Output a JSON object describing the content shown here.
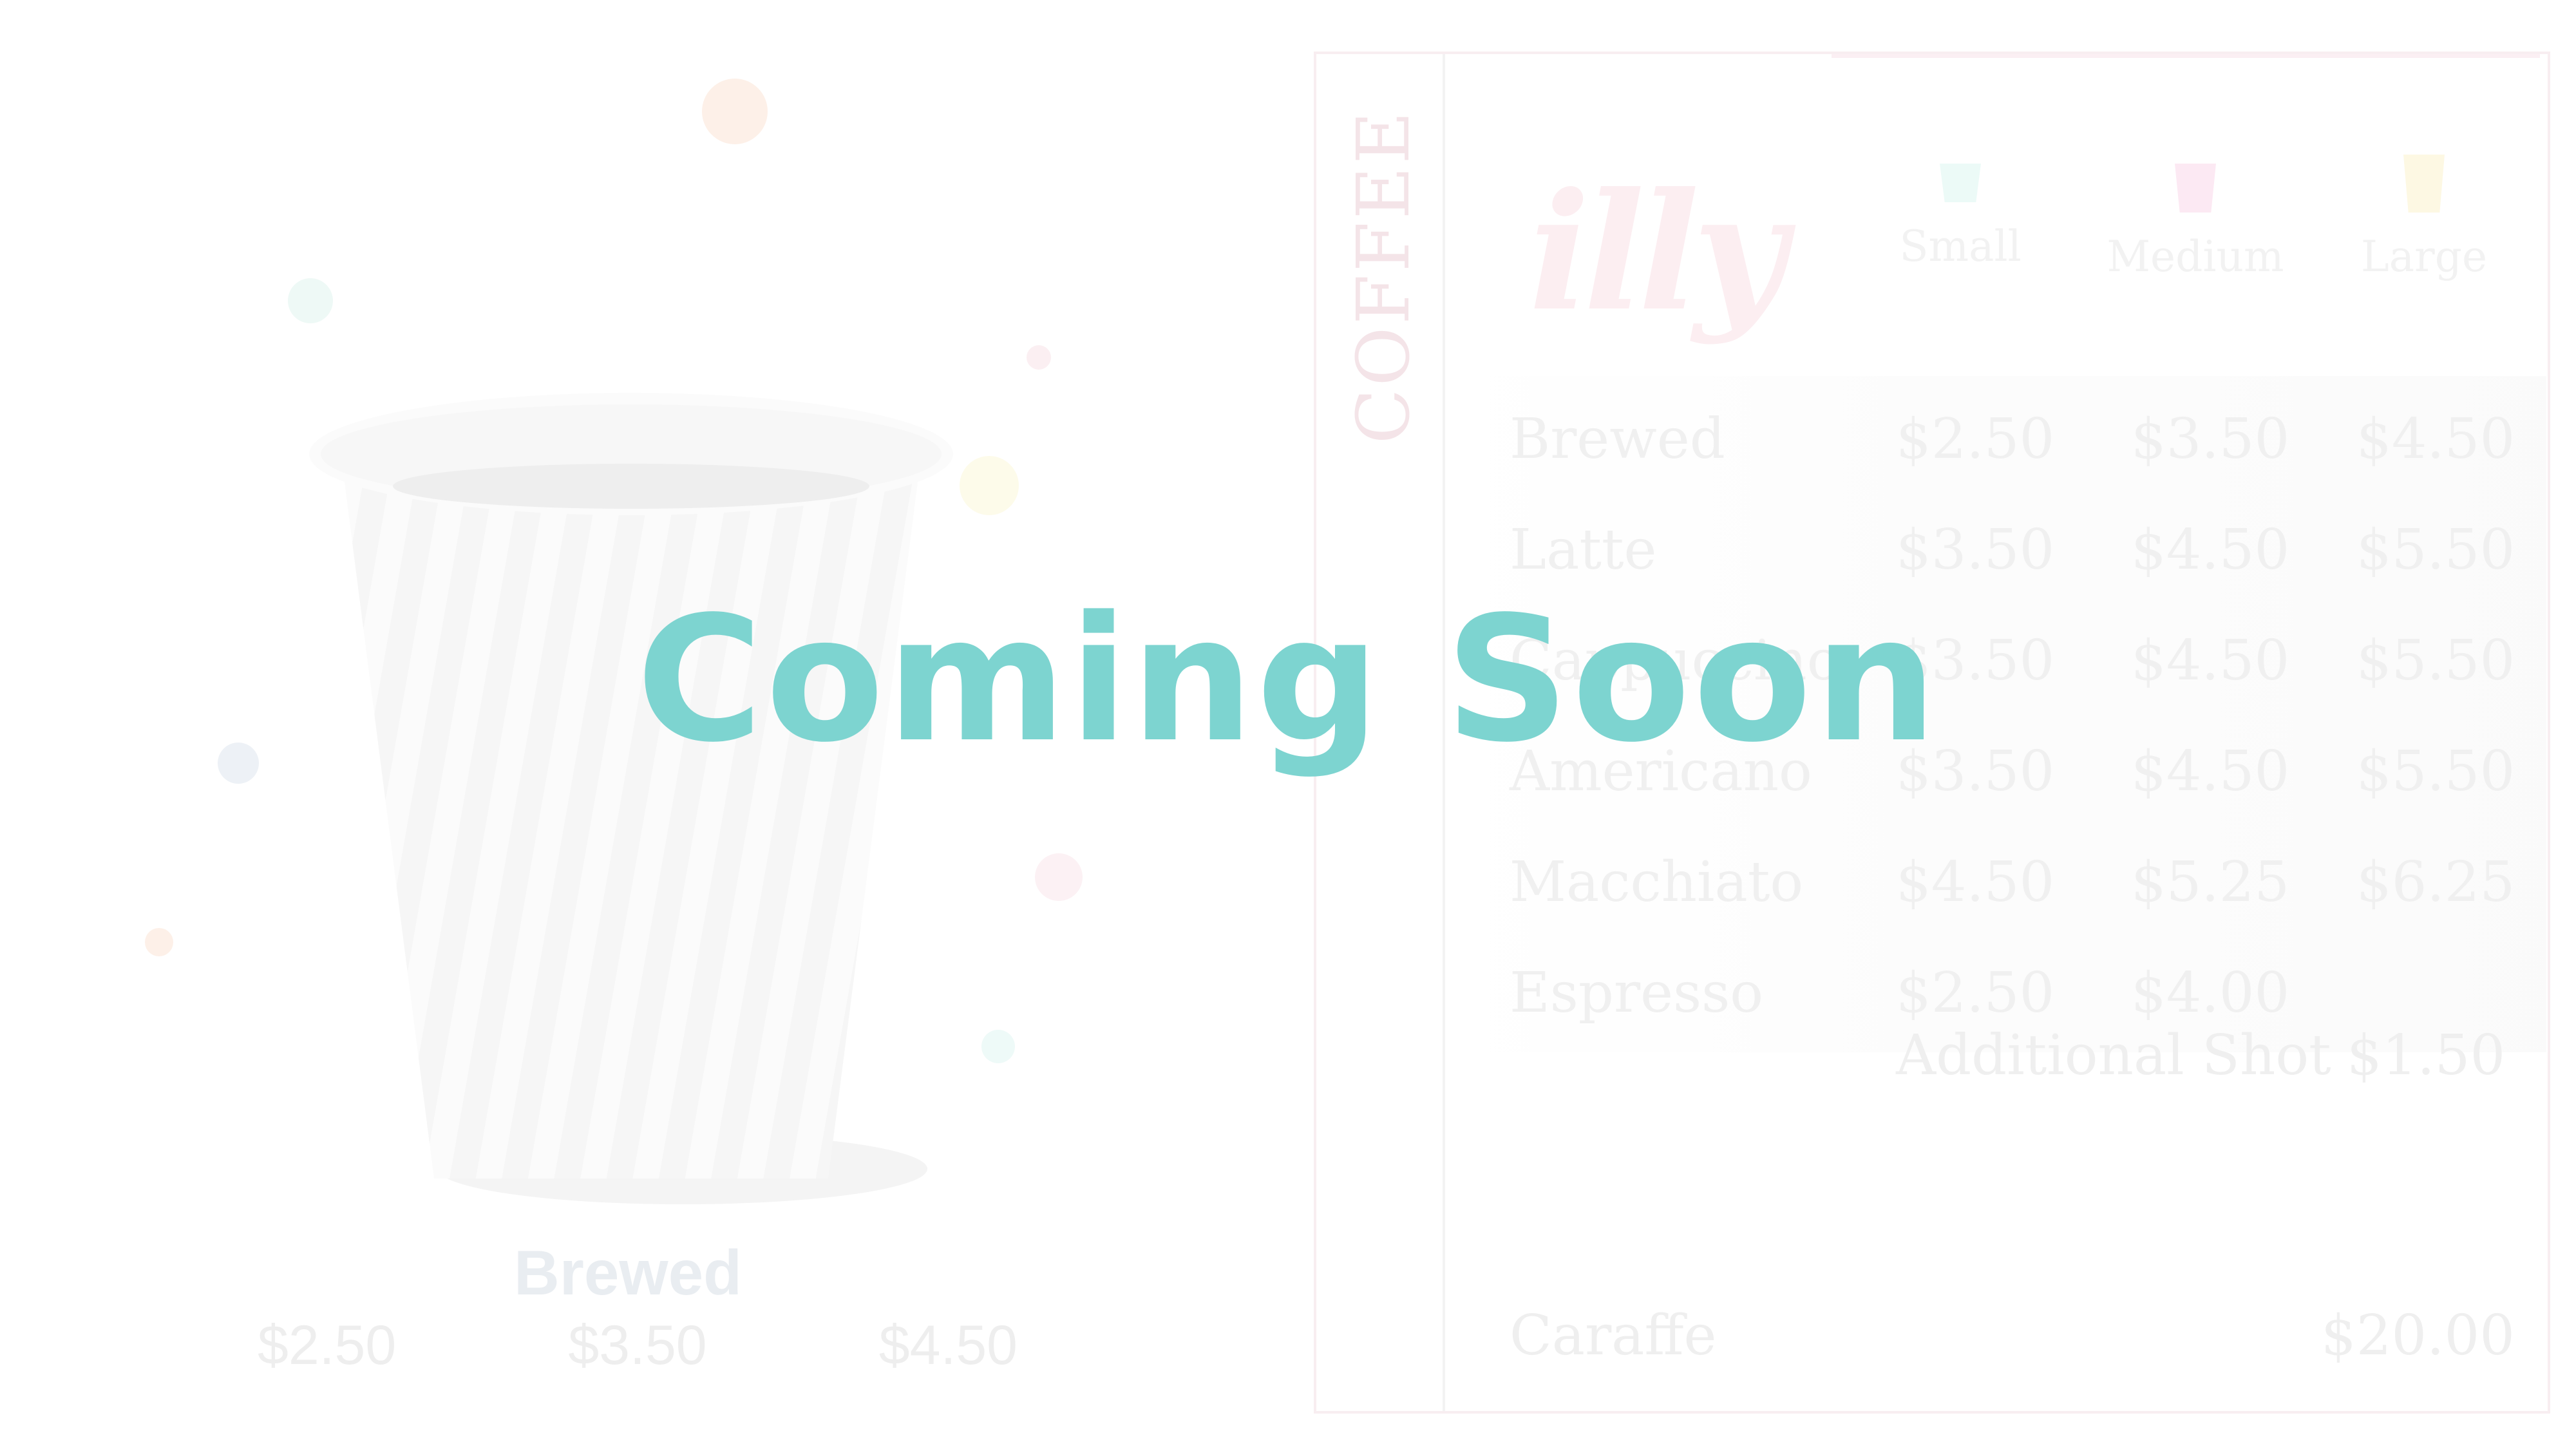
{
  "overlay": {
    "headline": "Coming Soon",
    "color": "#7dd4d0"
  },
  "featured": {
    "name": "Brewed",
    "prices": [
      "$2.50",
      "$3.50",
      "$4.50"
    ]
  },
  "menu": {
    "category": "COFFEE",
    "brand_logo_text": "illy",
    "sizes": [
      {
        "label": "Small",
        "icon": "small-cup-icon",
        "color": "#ecfaf7"
      },
      {
        "label": "Medium",
        "icon": "medium-cup-icon",
        "color": "#fce9f3"
      },
      {
        "label": "Large",
        "icon": "large-cup-icon",
        "color": "#fdf8e3"
      }
    ],
    "items": [
      {
        "name": "Brewed",
        "small": "$2.50",
        "medium": "$3.50",
        "large": "$4.50"
      },
      {
        "name": "Latte",
        "small": "$3.50",
        "medium": "$4.50",
        "large": "$5.50"
      },
      {
        "name": "Cappuccino",
        "small": "$3.50",
        "medium": "$4.50",
        "large": "$5.50"
      },
      {
        "name": "Americano",
        "small": "$3.50",
        "medium": "$4.50",
        "large": "$5.50"
      },
      {
        "name": "Macchiato",
        "small": "$4.50",
        "medium": "$5.25",
        "large": "$6.25"
      },
      {
        "name": "Espresso",
        "small": "$2.50",
        "medium": "$4.00",
        "large": ""
      }
    ],
    "additional_shot": {
      "label": "Additional Shot",
      "price": "$1.50"
    },
    "caraffe": {
      "label": "Caraffe",
      "price": "$20.00"
    }
  }
}
